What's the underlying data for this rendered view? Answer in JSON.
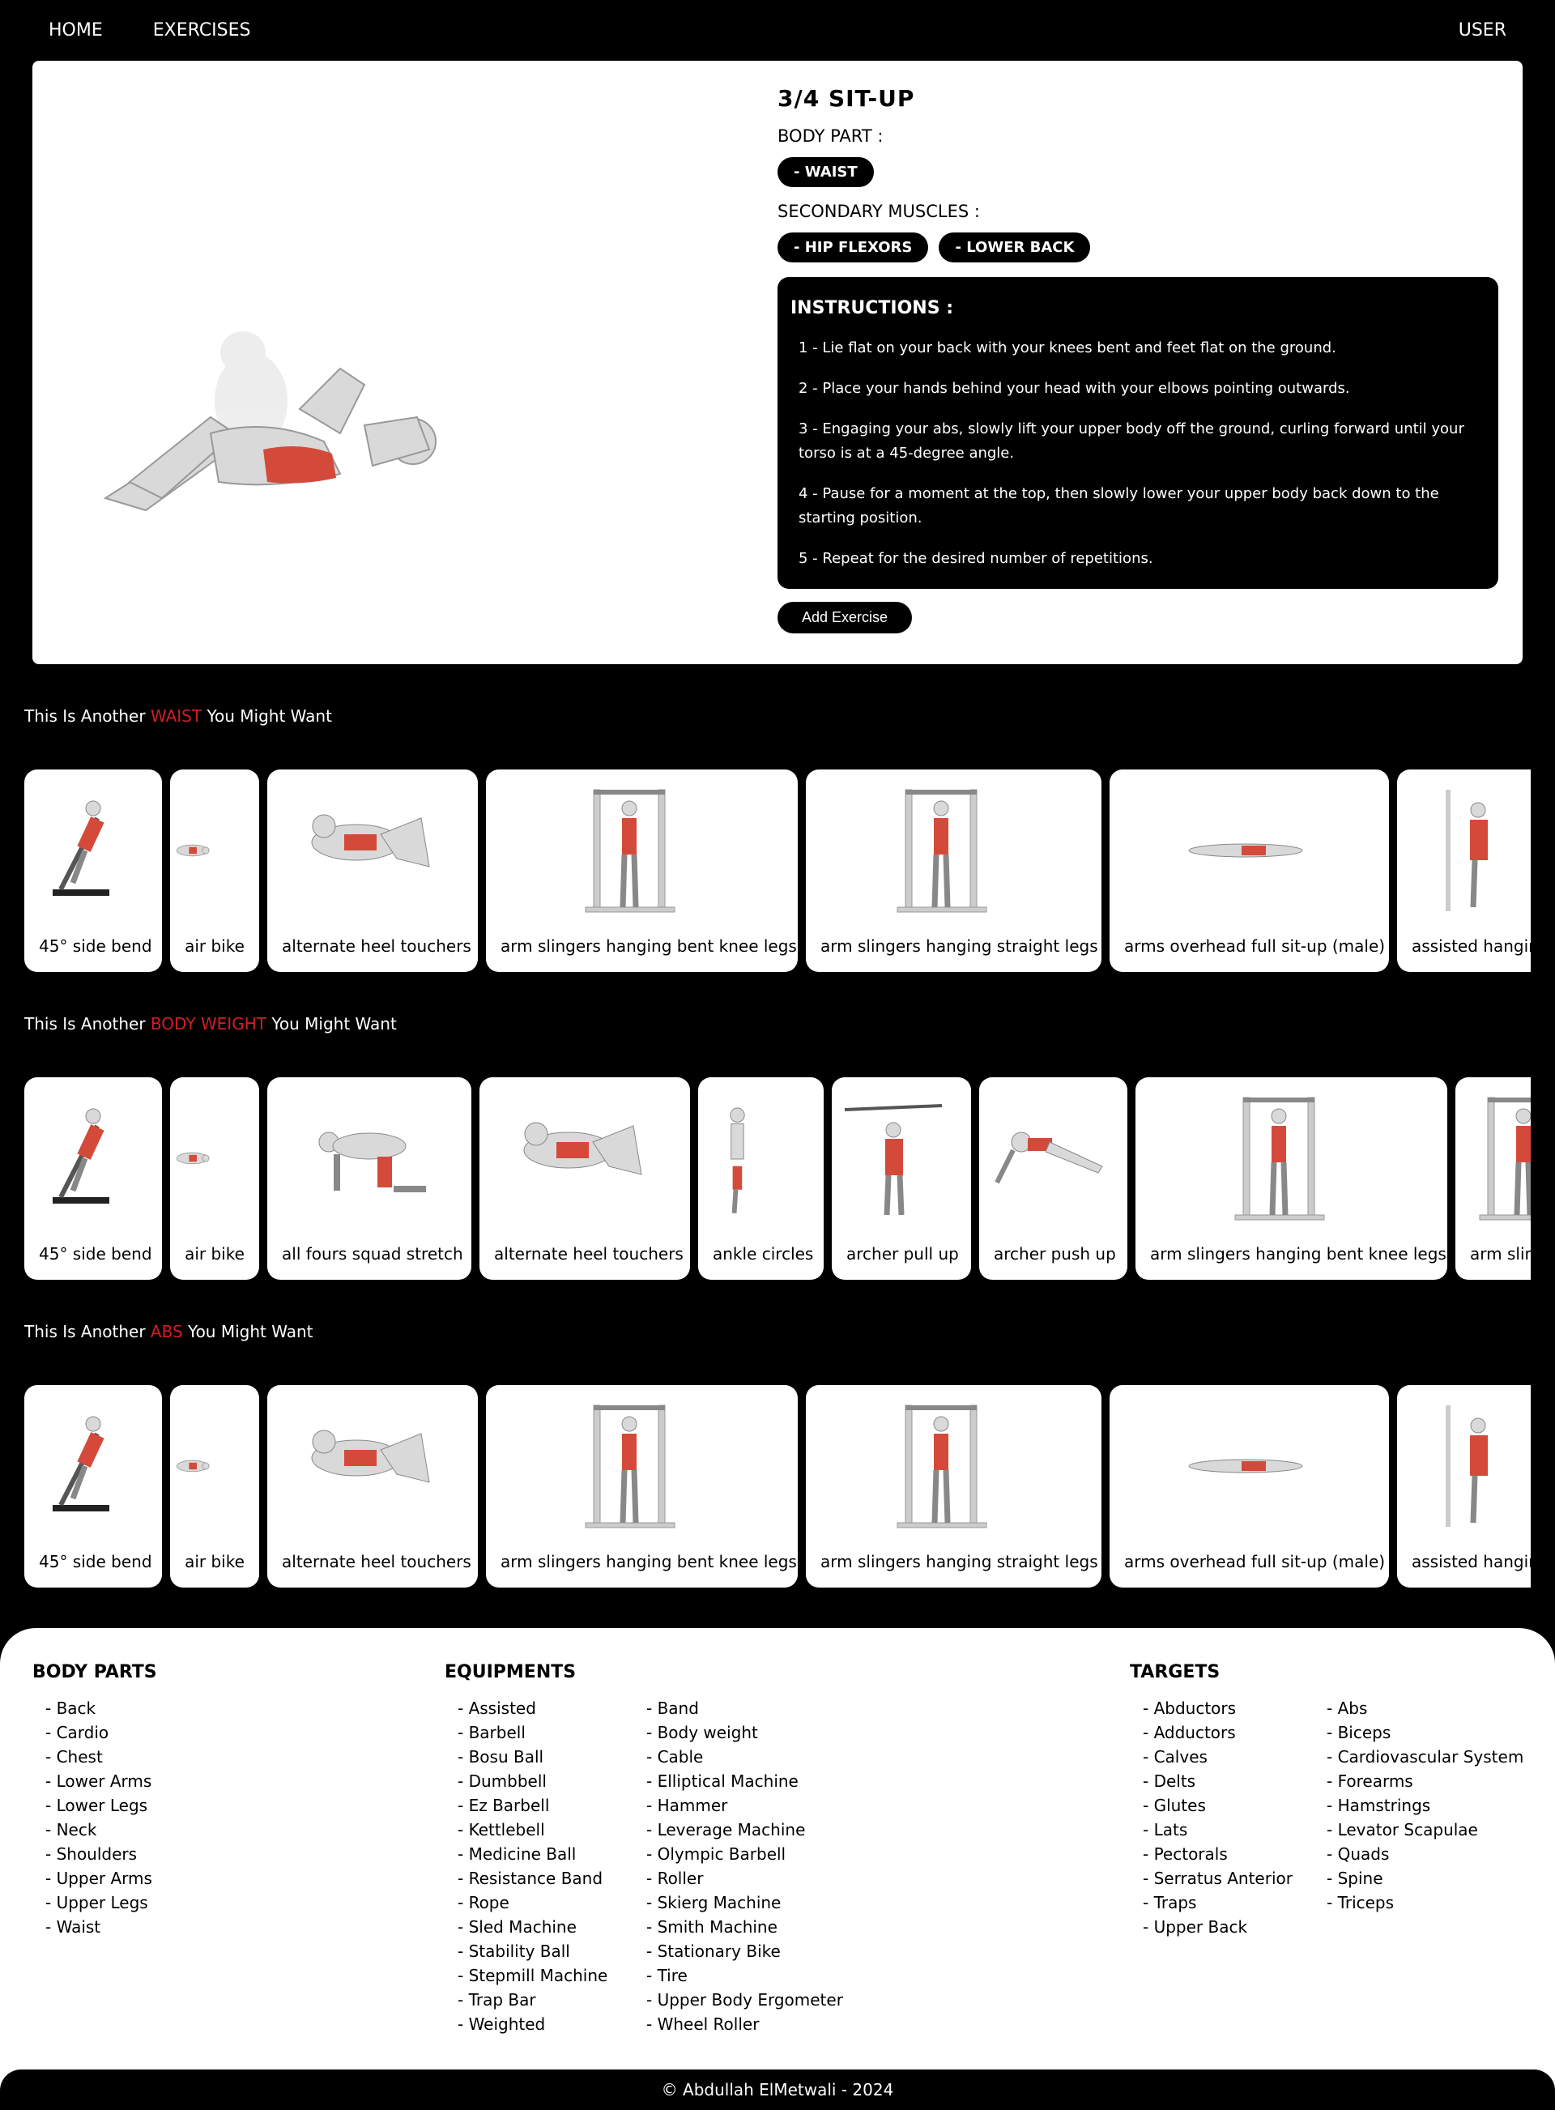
{
  "nav": {
    "home": "HOME",
    "exercises": "EXERCISES",
    "user": "USER"
  },
  "exercise": {
    "title": "3/4 SIT-UP",
    "body_part_label": "BODY PART :",
    "body_part": "- WAIST",
    "secondary_label": "SECONDARY MUSCLES :",
    "secondary": [
      "- HIP FLEXORS",
      "- LOWER BACK"
    ],
    "instructions_title": "INSTRUCTIONS :",
    "instructions": [
      "1 - Lie flat on your back with your knees bent and feet flat on the ground.",
      "2 - Place your hands behind your head with your elbows pointing outwards.",
      "3 - Engaging your abs, slowly lift your upper body off the ground, curling forward until your torso is at a 45-degree angle.",
      "4 - Pause for a moment at the top, then slowly lower your upper body back down to the starting position.",
      "5 - Repeat for the desired number of repetitions."
    ],
    "add_button": "Add Exercise"
  },
  "sections": [
    {
      "prefix": "This Is Another ",
      "highlight": "WAIST",
      "suffix": " You Might Want",
      "items": [
        {
          "name": "45° side bend",
          "icon": "bench-figure"
        },
        {
          "name": "air bike",
          "icon": "lying-figure"
        },
        {
          "name": "alternate heel touchers",
          "icon": "crunch-figure"
        },
        {
          "name": "arm slingers hanging bent knee legs",
          "icon": "power-rack-figure"
        },
        {
          "name": "arm slingers hanging straight legs",
          "icon": "power-rack-figure"
        },
        {
          "name": "arms overhead full sit-up (male)",
          "icon": "lying-flat-figure"
        },
        {
          "name": "assisted hanging knee raise",
          "icon": "hanging-figure"
        }
      ]
    },
    {
      "prefix": "This Is Another ",
      "highlight": "BODY WEIGHT",
      "suffix": " You Might Want",
      "items": [
        {
          "name": "45° side bend",
          "icon": "bench-figure"
        },
        {
          "name": "air bike",
          "icon": "lying-figure"
        },
        {
          "name": "all fours squad stretch",
          "icon": "all-fours-figure"
        },
        {
          "name": "alternate heel touchers",
          "icon": "crunch-figure"
        },
        {
          "name": "ankle circles",
          "icon": "standing-figure"
        },
        {
          "name": "archer pull up",
          "icon": "pull-up-figure"
        },
        {
          "name": "archer push up",
          "icon": "push-up-figure"
        },
        {
          "name": "arm slingers hanging bent knee legs",
          "icon": "power-rack-figure"
        },
        {
          "name": "arm slingers hanging straight legs",
          "icon": "power-rack-figure"
        }
      ]
    },
    {
      "prefix": "This Is Another ",
      "highlight": "ABS",
      "suffix": " You Might Want",
      "items": [
        {
          "name": "45° side bend",
          "icon": "bench-figure"
        },
        {
          "name": "air bike",
          "icon": "lying-figure"
        },
        {
          "name": "alternate heel touchers",
          "icon": "crunch-figure"
        },
        {
          "name": "arm slingers hanging bent knee legs",
          "icon": "power-rack-figure"
        },
        {
          "name": "arm slingers hanging straight legs",
          "icon": "power-rack-figure"
        },
        {
          "name": "arms overhead full sit-up (male)",
          "icon": "lying-flat-figure"
        },
        {
          "name": "assisted hanging knee raise",
          "icon": "hanging-figure"
        }
      ]
    }
  ],
  "footer": {
    "body_parts_title": "BODY PARTS",
    "body_parts": [
      "- Back",
      "- Cardio",
      "- Chest",
      "- Lower Arms",
      "- Lower Legs",
      "- Neck",
      "- Shoulders",
      "- Upper Arms",
      "- Upper Legs",
      "- Waist"
    ],
    "equipments_title": "EQUIPMENTS",
    "equipments_col1": [
      "- Assisted",
      "- Barbell",
      "- Bosu Ball",
      "- Dumbbell",
      "- Ez Barbell",
      "- Kettlebell",
      "- Medicine Ball",
      "- Resistance Band",
      "- Rope",
      "- Sled Machine",
      "- Stability Ball",
      "- Stepmill Machine",
      "- Trap Bar",
      "- Weighted"
    ],
    "equipments_col2": [
      "- Band",
      "- Body weight",
      "- Cable",
      "- Elliptical Machine",
      "- Hammer",
      "- Leverage Machine",
      "- Olympic Barbell",
      "- Roller",
      "- Skierg Machine",
      "- Smith Machine",
      "- Stationary Bike",
      "- Tire",
      "- Upper Body Ergometer",
      "- Wheel Roller"
    ],
    "targets_title": "TARGETS",
    "targets_col1": [
      "- Abductors",
      "- Adductors",
      "- Calves",
      "- Delts",
      "- Glutes",
      "- Lats",
      "- Pectorals",
      "- Serratus Anterior",
      "- Traps",
      "- Upper Back"
    ],
    "targets_col2": [
      "- Abs",
      "- Biceps",
      "- Cardiovascular System",
      "- Forearms",
      "- Hamstrings",
      "- Levator Scapulae",
      "- Quads",
      "- Spine",
      "- Triceps"
    ],
    "copyright": "© Abdullah ElMetwali - 2024"
  },
  "colors": {
    "accent": "#d11f25",
    "background": "#000000",
    "card": "#ffffff"
  }
}
